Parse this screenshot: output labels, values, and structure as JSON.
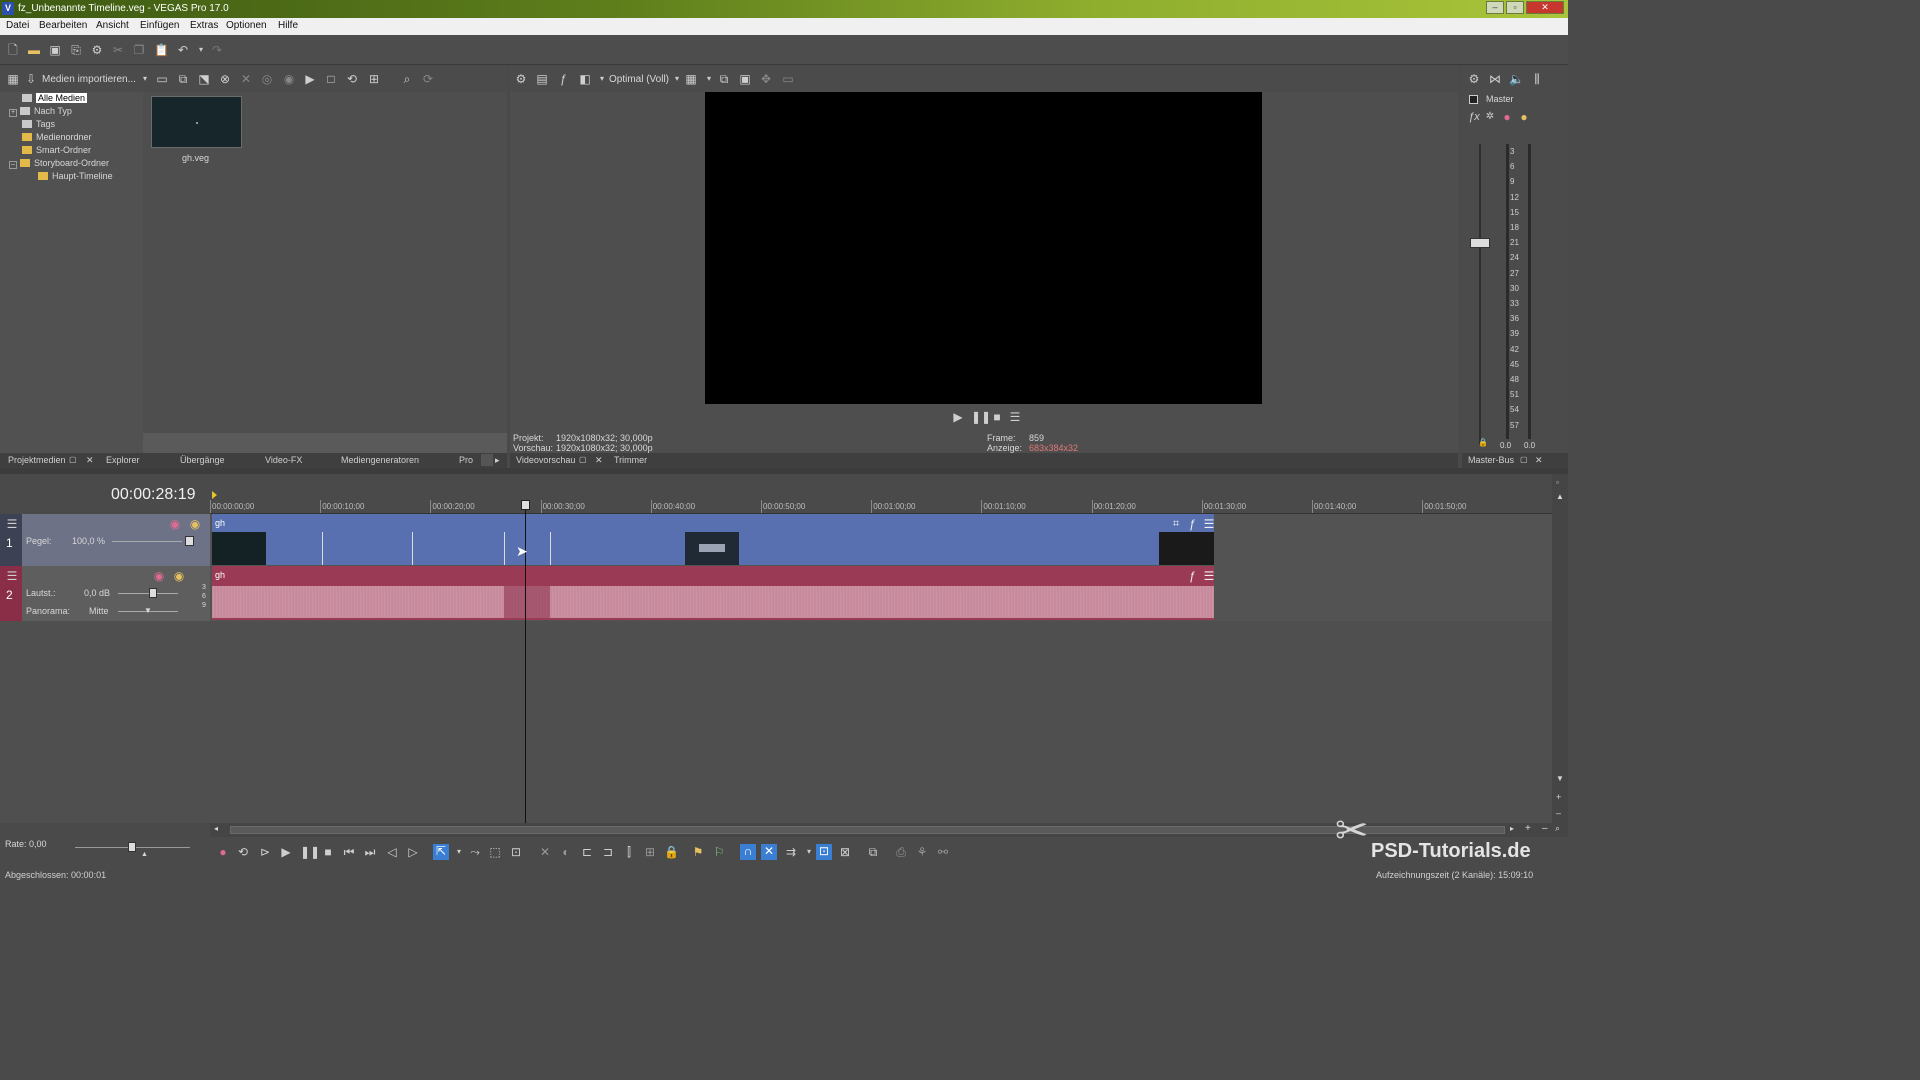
{
  "window": {
    "title": "fz_Unbenannte Timeline.veg - VEGAS Pro 17.0",
    "app_icon": "V",
    "buttons": [
      "–",
      "▫",
      "✕"
    ]
  },
  "menu": [
    "Datei",
    "Bearbeiten",
    "Ansicht",
    "Einfügen",
    "Extras",
    "Optionen",
    "Hilfe"
  ],
  "media": {
    "import_label": "Medien importieren...",
    "tree": [
      {
        "label": "Alle Medien",
        "selected": true
      },
      {
        "label": "Nach Typ"
      },
      {
        "label": "Tags"
      },
      {
        "label": "Medienordner"
      },
      {
        "label": "Smart-Ordner"
      },
      {
        "label": "Storyboard-Ordner"
      },
      {
        "label": "Haupt-Timeline"
      }
    ],
    "thumb_label": "gh.veg",
    "tabs": [
      "Projektmedien",
      "Explorer",
      "Übergänge",
      "Video-FX",
      "Mediengeneratoren",
      "Pro"
    ]
  },
  "preview": {
    "quality": "Optimal (Voll)",
    "projekt_label": "Projekt:",
    "projekt_value": "1920x1080x32; 30,000p",
    "vorschau_label": "Vorschau:",
    "vorschau_value": "1920x1080x32; 30,000p",
    "frame_label": "Frame:",
    "frame_value": "859",
    "anzeige_label": "Anzeige:",
    "anzeige_value": "683x384x32",
    "tabs": [
      "Videovorschau",
      "Trimmer"
    ]
  },
  "master": {
    "label": "Master",
    "ticks": [
      "3",
      "6",
      "9",
      "12",
      "15",
      "18",
      "21",
      "24",
      "27",
      "30",
      "33",
      "36",
      "39",
      "42",
      "45",
      "48",
      "51",
      "54",
      "57"
    ],
    "bottom_left": "0.0",
    "bottom_right": "0.0",
    "tab": "Master-Bus"
  },
  "timeline": {
    "timecode": "00:00:28:19",
    "ruler": [
      "00:00:00;00",
      "00:00:10;00",
      "00:00:20;00",
      "00:00:30;00",
      "00:00:40;00",
      "00:00:50;00",
      "00:01:00;00",
      "00:01:10;00",
      "00:01:20;00",
      "00:01:30;00",
      "00:01:40;00",
      "00:01:50;00"
    ],
    "video_track": {
      "number": "1",
      "pegel_label": "Pegel:",
      "pegel_value": "100,0 %",
      "clip_name": "gh"
    },
    "audio_track": {
      "number": "2",
      "volume_label": "Lautst.:",
      "volume_value": "0,0 dB",
      "pan_label": "Panorama:",
      "pan_value": "Mitte",
      "clip_name": "gh",
      "scale": [
        "3",
        "6",
        "9"
      ]
    },
    "rate_label": "Rate: 0,00"
  },
  "status": {
    "left": "Abgeschlossen: 00:00:01",
    "right": "Aufzeichnungszeit (2 Kanäle): 15:09:10"
  },
  "watermark": "PSD-Tutorials.de"
}
